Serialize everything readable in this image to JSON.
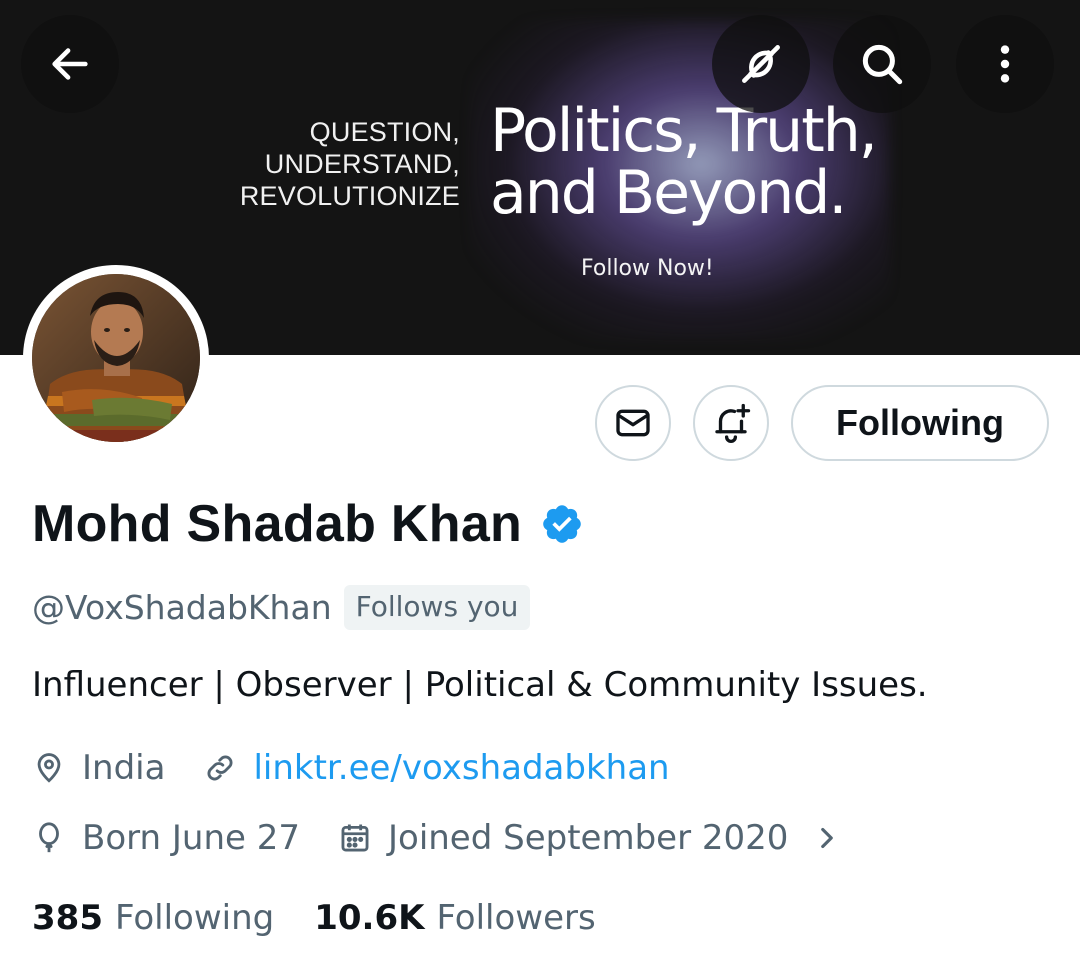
{
  "banner": {
    "tagline_lines": [
      "QUESTION,",
      "UNDERSTAND,",
      "REVOLUTIONIZE"
    ],
    "title_lines": [
      "Politics, Truth,",
      "and Beyond."
    ],
    "cta": "Follow Now!"
  },
  "top_bar": {
    "icons": [
      "back-arrow-icon",
      "grok-icon",
      "search-icon",
      "more-vertical-icon"
    ]
  },
  "profile": {
    "display_name": "Mohd Shadab Khan",
    "verified": true,
    "verified_color": "#1d9bf0",
    "handle": "@VoxShadabKhan",
    "follows_you": "Follows you",
    "bio": "Influencer | Observer | Political & Community Issues.",
    "location": "India",
    "website": "linktr.ee/voxshadabkhan",
    "birthday": "Born June 27",
    "joined": "Joined September 2020"
  },
  "actions": {
    "message_icon": "mail-icon",
    "notify_icon": "bell-plus-icon",
    "following_label": "Following"
  },
  "stats": {
    "following_count": "385",
    "following_label": "Following",
    "followers_count": "10.6K",
    "followers_label": "Followers"
  },
  "colors": {
    "accent": "#1d9bf0",
    "secondary_text": "#536471",
    "primary_text": "#0f1419",
    "banner_bg": "#141414"
  }
}
